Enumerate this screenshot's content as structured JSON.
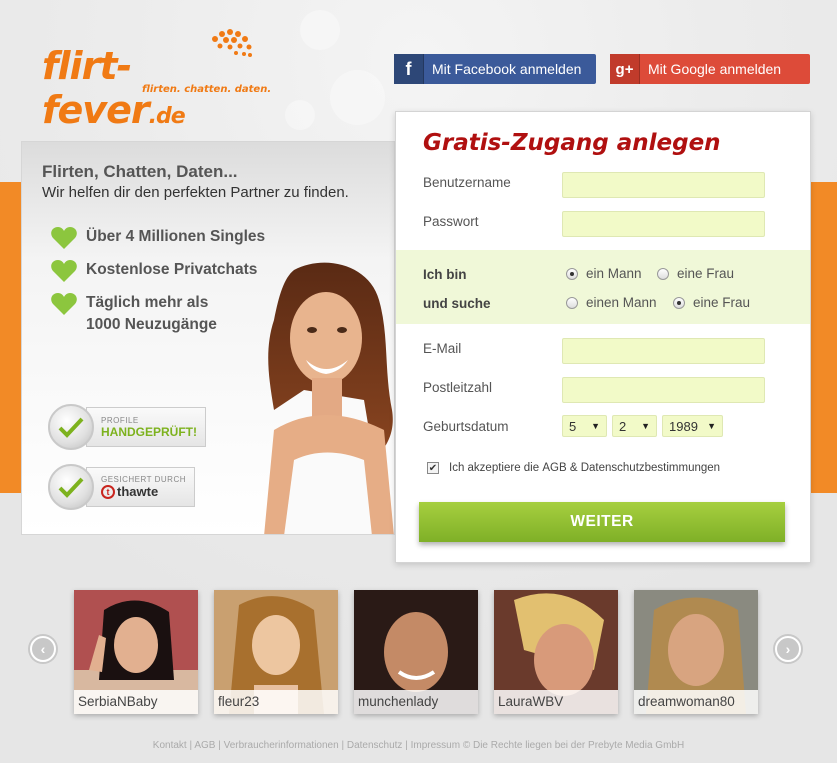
{
  "brand": {
    "logo_main": "flirt-fever",
    "logo_tld": ".de",
    "slogan": "flirten. chatten. daten."
  },
  "social": {
    "facebook_label": "Mit Facebook anmelden",
    "facebook_icon": "f",
    "google_label": "Mit Google anmelden",
    "google_icon": "g+"
  },
  "promo": {
    "title": "Flirten, Chatten, Daten...",
    "subtitle": "Wir helfen dir den perfekten Partner zu finden.",
    "features": [
      "Über 4 Millionen Singles",
      "Kostenlose Privatchats",
      "Täglich mehr als",
      "1000 Neuzugänge"
    ],
    "badge1_small": "PROFILE",
    "badge1_big": "HANDGEPRÜFT!",
    "badge2_small": "GESICHERT DURCH",
    "badge2_brand": "thawte"
  },
  "form": {
    "title": "Gratis-Zugang anlegen",
    "username_label": "Benutzername",
    "password_label": "Passwort",
    "i_am_label": "Ich bin",
    "seeking_label": "und suche",
    "i_am_options": [
      "ein Mann",
      "eine Frau"
    ],
    "seeking_options": [
      "einen Mann",
      "eine Frau"
    ],
    "email_label": "E-Mail",
    "zip_label": "Postleitzahl",
    "birthdate_label": "Geburtsdatum",
    "birth_day": "5",
    "birth_month": "2",
    "birth_year": "1989",
    "agb_prefix": "Ich akzeptiere die",
    "agb_link": "AGB",
    "agb_amp": "&",
    "privacy_link": "Datenschutzbestimmungen",
    "submit_label": "WEITER"
  },
  "profiles": [
    "SerbiaNBaby",
    "fleur23",
    "munchenlady",
    "LauraWBV",
    "dreamwoman80"
  ],
  "footer": {
    "links": [
      "Kontakt",
      "AGB",
      "Verbraucherinformationen",
      "Datenschutz",
      "Impressum"
    ],
    "separator": " | ",
    "copyright": "© Die Rechte liegen bei der Prebyte Media GmbH"
  },
  "colors": {
    "orange": "#f28a26",
    "facebook": "#3b5a9a",
    "google": "#dd4b39",
    "green_button": "#8bbd2e",
    "title_red": "#b01010",
    "input_bg": "#f2fac8"
  }
}
